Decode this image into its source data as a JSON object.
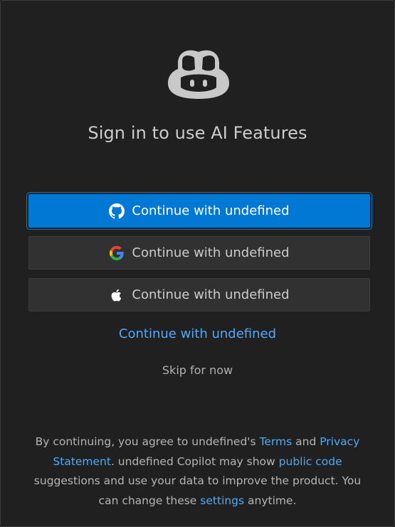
{
  "dialog": {
    "title": "Sign in to use AI Features",
    "logo_icon": "copilot-icon",
    "buttons": {
      "primary": {
        "label": "Continue with undefined",
        "icon": "github-icon"
      },
      "google": {
        "label": "Continue with undefined",
        "icon": "google-icon"
      },
      "apple": {
        "label": "Continue with undefined",
        "icon": "apple-icon"
      }
    },
    "link_button": "Continue with undefined",
    "skip_label": "Skip for now",
    "legal": {
      "part1": "By continuing, you agree to undefined's ",
      "terms_link": "Terms",
      "part2": " and ",
      "privacy_link": "Privacy Statement",
      "part3": ". undefined Copilot may show ",
      "public_code_link": "public code",
      "part4": " suggestions and use your data to improve the product. You can change these ",
      "settings_link": "settings",
      "part5": " anytime."
    }
  },
  "colors": {
    "background": "#202020",
    "primary_button": "#0078d4",
    "secondary_button": "#313131",
    "link": "#4daafc"
  }
}
